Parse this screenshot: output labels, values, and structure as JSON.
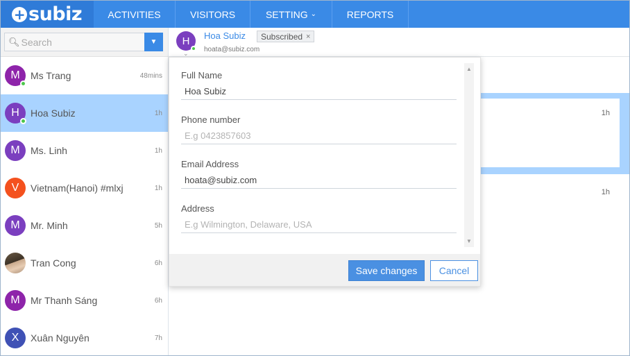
{
  "brand": {
    "logo_text": "subiz"
  },
  "nav": {
    "tabs": [
      {
        "label": "ACTIVITIES"
      },
      {
        "label": "VISITORS"
      },
      {
        "label": "SETTING"
      },
      {
        "label": "REPORTS"
      }
    ]
  },
  "sidebar": {
    "search_placeholder": "Search",
    "conversations": [
      {
        "initial": "M",
        "name": "Ms Trang",
        "time": "48mins",
        "color": "#8e24aa",
        "online": true
      },
      {
        "initial": "H",
        "name": "Hoa Subiz",
        "time": "1h",
        "color": "#7b3fbf",
        "online": true,
        "selected": true
      },
      {
        "initial": "M",
        "name": "Ms. Linh",
        "time": "1h",
        "color": "#7b3fbf"
      },
      {
        "initial": "V",
        "name": "Vietnam(Hanoi) #mlxj",
        "time": "1h",
        "color": "#f4511e"
      },
      {
        "initial": "M",
        "name": "Mr. Minh",
        "time": "5h",
        "color": "#7b3fbf"
      },
      {
        "initial": "",
        "name": "Tran Cong",
        "time": "6h",
        "photo": true
      },
      {
        "initial": "M",
        "name": "Mr Thanh Sáng",
        "time": "6h",
        "color": "#8e24aa"
      },
      {
        "initial": "X",
        "name": "Xuân Nguyên",
        "time": "7h",
        "color": "#3f51b5"
      }
    ]
  },
  "main": {
    "contact": {
      "initial": "H",
      "name": "Hoa Subiz",
      "badge": "Subscribed",
      "badge_close": "×",
      "email": "hoata@subiz.com"
    },
    "activity_times": [
      "1h",
      "1h"
    ]
  },
  "editor": {
    "fields": [
      {
        "label": "Full Name",
        "value": "Hoa Subiz",
        "placeholder": ""
      },
      {
        "label": "Phone number",
        "value": "",
        "placeholder": "E.g 0423857603"
      },
      {
        "label": "Email Address",
        "value": "hoata@subiz.com",
        "placeholder": ""
      },
      {
        "label": "Address",
        "value": "",
        "placeholder": "E.g Wilmington, Delaware, USA"
      }
    ],
    "save_label": "Save changes",
    "cancel_label": "Cancel"
  },
  "colors": {
    "accent": "#3a8ae6",
    "selected_row": "#a9d3ff",
    "online": "#4cc74c"
  }
}
